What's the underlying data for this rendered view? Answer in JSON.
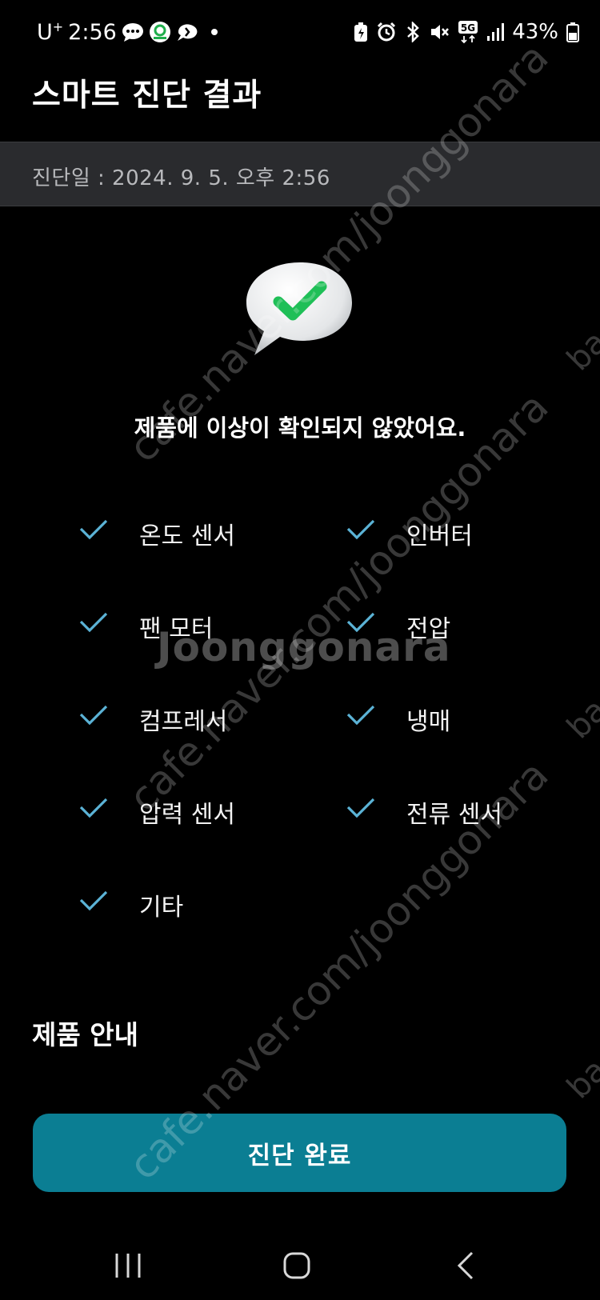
{
  "status_bar": {
    "carrier": "U",
    "carrier_sup": "+",
    "time": "2:56",
    "network": "5G",
    "battery": "43%"
  },
  "header": {
    "title": "스마트 진단 결과"
  },
  "diagnosis": {
    "date_label": "진단일 : 2024. 9. 5. 오후 2:56",
    "result_message": "제품에 이상이 확인되지 않았어요."
  },
  "checks": [
    {
      "label": "온도 센서",
      "status": "ok"
    },
    {
      "label": "인버터",
      "status": "ok"
    },
    {
      "label": "팬 모터",
      "status": "ok"
    },
    {
      "label": "전압",
      "status": "ok"
    },
    {
      "label": "컴프레서",
      "status": "ok"
    },
    {
      "label": "냉매",
      "status": "ok"
    },
    {
      "label": "압력 센서",
      "status": "ok"
    },
    {
      "label": "전류 센서",
      "status": "ok"
    },
    {
      "label": "기타",
      "status": "ok"
    }
  ],
  "section": {
    "product_guide_title": "제품 안내"
  },
  "actions": {
    "done_label": "진단 완료"
  },
  "watermarks": {
    "cafe": "cafe.naver.com/joonggonara",
    "brand": "Joonggonara",
    "edge": "ba"
  },
  "colors": {
    "background": "#000000",
    "date_bar": "#2a2b2e",
    "accent_button": "#0b7e93",
    "check": "#5bb3d6",
    "bubble_check": "#20c35a"
  },
  "icons": {
    "result": "speech-bubble-check-icon",
    "check": "check-icon",
    "nav_recents": "recents-icon",
    "nav_home": "home-icon",
    "nav_back": "back-icon"
  }
}
